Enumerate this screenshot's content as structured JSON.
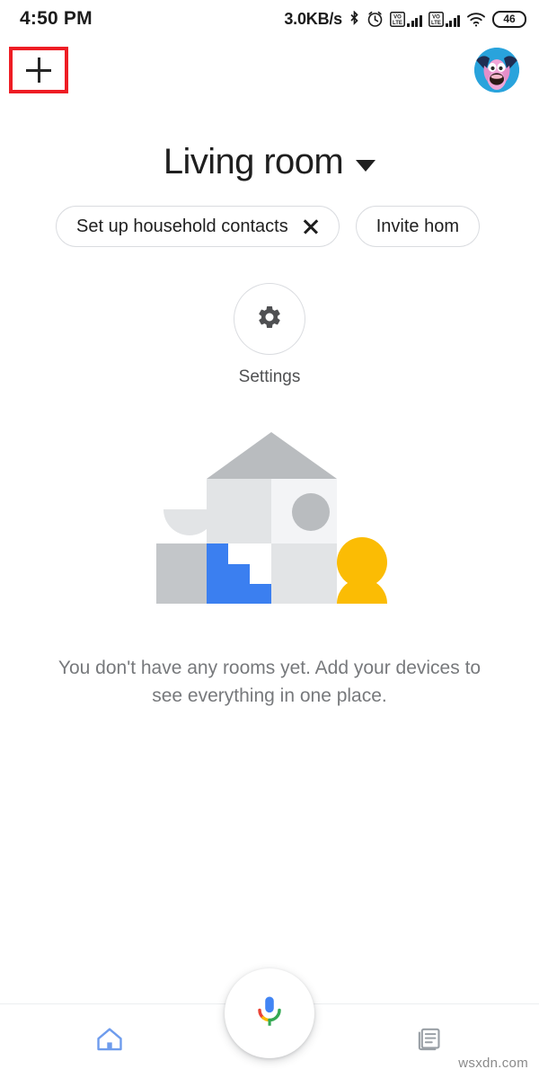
{
  "status_bar": {
    "time": "4:50 PM",
    "network_speed": "3.0KB/s",
    "battery_level": "46",
    "icons": [
      "bluetooth-icon",
      "alarm-icon",
      "volte-sim1-icon",
      "signal-sim1-icon",
      "volte-sim2-icon",
      "signal-sim2-icon",
      "wifi-icon",
      "battery-icon"
    ]
  },
  "topbar": {
    "add_label": "+",
    "add_icon": "plus-icon",
    "avatar_icon": "account-avatar",
    "highlight_color": "#ee1d24"
  },
  "home": {
    "title": "Living room",
    "dropdown_icon": "chevron-down-icon"
  },
  "chips": [
    {
      "label": "Set up household contacts",
      "dismiss_icon": "close-icon",
      "has_dismiss": true
    },
    {
      "label": "Invite hom",
      "has_dismiss": false
    }
  ],
  "settings": {
    "label": "Settings",
    "icon": "gear-icon"
  },
  "empty_state": {
    "illustration": "house-rooms-illustration",
    "message": "You don't have any rooms yet. Add your devices to see everything in one place."
  },
  "assistant": {
    "icon": "google-assistant-mic-icon"
  },
  "bottom_nav": [
    {
      "name": "home",
      "icon": "home-icon",
      "active": true,
      "color": "#6e9ced"
    },
    {
      "name": "feed",
      "icon": "feed-icon",
      "active": false,
      "color": "#9aa0a6"
    }
  ],
  "watermark": "wsxdn.com"
}
